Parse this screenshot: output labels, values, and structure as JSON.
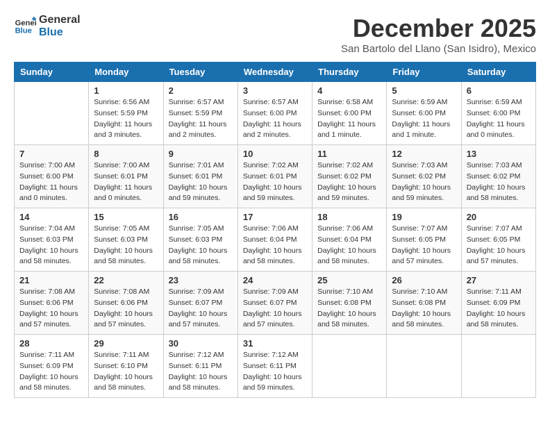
{
  "header": {
    "logo_line1": "General",
    "logo_line2": "Blue",
    "month": "December 2025",
    "location": "San Bartolo del Llano (San Isidro), Mexico"
  },
  "days_of_week": [
    "Sunday",
    "Monday",
    "Tuesday",
    "Wednesday",
    "Thursday",
    "Friday",
    "Saturday"
  ],
  "weeks": [
    [
      {
        "day": "",
        "sunrise": "",
        "sunset": "",
        "daylight": ""
      },
      {
        "day": "1",
        "sunrise": "Sunrise: 6:56 AM",
        "sunset": "Sunset: 5:59 PM",
        "daylight": "Daylight: 11 hours and 3 minutes."
      },
      {
        "day": "2",
        "sunrise": "Sunrise: 6:57 AM",
        "sunset": "Sunset: 5:59 PM",
        "daylight": "Daylight: 11 hours and 2 minutes."
      },
      {
        "day": "3",
        "sunrise": "Sunrise: 6:57 AM",
        "sunset": "Sunset: 6:00 PM",
        "daylight": "Daylight: 11 hours and 2 minutes."
      },
      {
        "day": "4",
        "sunrise": "Sunrise: 6:58 AM",
        "sunset": "Sunset: 6:00 PM",
        "daylight": "Daylight: 11 hours and 1 minute."
      },
      {
        "day": "5",
        "sunrise": "Sunrise: 6:59 AM",
        "sunset": "Sunset: 6:00 PM",
        "daylight": "Daylight: 11 hours and 1 minute."
      },
      {
        "day": "6",
        "sunrise": "Sunrise: 6:59 AM",
        "sunset": "Sunset: 6:00 PM",
        "daylight": "Daylight: 11 hours and 0 minutes."
      }
    ],
    [
      {
        "day": "7",
        "sunrise": "Sunrise: 7:00 AM",
        "sunset": "Sunset: 6:00 PM",
        "daylight": "Daylight: 11 hours and 0 minutes."
      },
      {
        "day": "8",
        "sunrise": "Sunrise: 7:00 AM",
        "sunset": "Sunset: 6:01 PM",
        "daylight": "Daylight: 11 hours and 0 minutes."
      },
      {
        "day": "9",
        "sunrise": "Sunrise: 7:01 AM",
        "sunset": "Sunset: 6:01 PM",
        "daylight": "Daylight: 10 hours and 59 minutes."
      },
      {
        "day": "10",
        "sunrise": "Sunrise: 7:02 AM",
        "sunset": "Sunset: 6:01 PM",
        "daylight": "Daylight: 10 hours and 59 minutes."
      },
      {
        "day": "11",
        "sunrise": "Sunrise: 7:02 AM",
        "sunset": "Sunset: 6:02 PM",
        "daylight": "Daylight: 10 hours and 59 minutes."
      },
      {
        "day": "12",
        "sunrise": "Sunrise: 7:03 AM",
        "sunset": "Sunset: 6:02 PM",
        "daylight": "Daylight: 10 hours and 59 minutes."
      },
      {
        "day": "13",
        "sunrise": "Sunrise: 7:03 AM",
        "sunset": "Sunset: 6:02 PM",
        "daylight": "Daylight: 10 hours and 58 minutes."
      }
    ],
    [
      {
        "day": "14",
        "sunrise": "Sunrise: 7:04 AM",
        "sunset": "Sunset: 6:03 PM",
        "daylight": "Daylight: 10 hours and 58 minutes."
      },
      {
        "day": "15",
        "sunrise": "Sunrise: 7:05 AM",
        "sunset": "Sunset: 6:03 PM",
        "daylight": "Daylight: 10 hours and 58 minutes."
      },
      {
        "day": "16",
        "sunrise": "Sunrise: 7:05 AM",
        "sunset": "Sunset: 6:03 PM",
        "daylight": "Daylight: 10 hours and 58 minutes."
      },
      {
        "day": "17",
        "sunrise": "Sunrise: 7:06 AM",
        "sunset": "Sunset: 6:04 PM",
        "daylight": "Daylight: 10 hours and 58 minutes."
      },
      {
        "day": "18",
        "sunrise": "Sunrise: 7:06 AM",
        "sunset": "Sunset: 6:04 PM",
        "daylight": "Daylight: 10 hours and 58 minutes."
      },
      {
        "day": "19",
        "sunrise": "Sunrise: 7:07 AM",
        "sunset": "Sunset: 6:05 PM",
        "daylight": "Daylight: 10 hours and 57 minutes."
      },
      {
        "day": "20",
        "sunrise": "Sunrise: 7:07 AM",
        "sunset": "Sunset: 6:05 PM",
        "daylight": "Daylight: 10 hours and 57 minutes."
      }
    ],
    [
      {
        "day": "21",
        "sunrise": "Sunrise: 7:08 AM",
        "sunset": "Sunset: 6:06 PM",
        "daylight": "Daylight: 10 hours and 57 minutes."
      },
      {
        "day": "22",
        "sunrise": "Sunrise: 7:08 AM",
        "sunset": "Sunset: 6:06 PM",
        "daylight": "Daylight: 10 hours and 57 minutes."
      },
      {
        "day": "23",
        "sunrise": "Sunrise: 7:09 AM",
        "sunset": "Sunset: 6:07 PM",
        "daylight": "Daylight: 10 hours and 57 minutes."
      },
      {
        "day": "24",
        "sunrise": "Sunrise: 7:09 AM",
        "sunset": "Sunset: 6:07 PM",
        "daylight": "Daylight: 10 hours and 57 minutes."
      },
      {
        "day": "25",
        "sunrise": "Sunrise: 7:10 AM",
        "sunset": "Sunset: 6:08 PM",
        "daylight": "Daylight: 10 hours and 58 minutes."
      },
      {
        "day": "26",
        "sunrise": "Sunrise: 7:10 AM",
        "sunset": "Sunset: 6:08 PM",
        "daylight": "Daylight: 10 hours and 58 minutes."
      },
      {
        "day": "27",
        "sunrise": "Sunrise: 7:11 AM",
        "sunset": "Sunset: 6:09 PM",
        "daylight": "Daylight: 10 hours and 58 minutes."
      }
    ],
    [
      {
        "day": "28",
        "sunrise": "Sunrise: 7:11 AM",
        "sunset": "Sunset: 6:09 PM",
        "daylight": "Daylight: 10 hours and 58 minutes."
      },
      {
        "day": "29",
        "sunrise": "Sunrise: 7:11 AM",
        "sunset": "Sunset: 6:10 PM",
        "daylight": "Daylight: 10 hours and 58 minutes."
      },
      {
        "day": "30",
        "sunrise": "Sunrise: 7:12 AM",
        "sunset": "Sunset: 6:11 PM",
        "daylight": "Daylight: 10 hours and 58 minutes."
      },
      {
        "day": "31",
        "sunrise": "Sunrise: 7:12 AM",
        "sunset": "Sunset: 6:11 PM",
        "daylight": "Daylight: 10 hours and 59 minutes."
      },
      {
        "day": "",
        "sunrise": "",
        "sunset": "",
        "daylight": ""
      },
      {
        "day": "",
        "sunrise": "",
        "sunset": "",
        "daylight": ""
      },
      {
        "day": "",
        "sunrise": "",
        "sunset": "",
        "daylight": ""
      }
    ]
  ]
}
